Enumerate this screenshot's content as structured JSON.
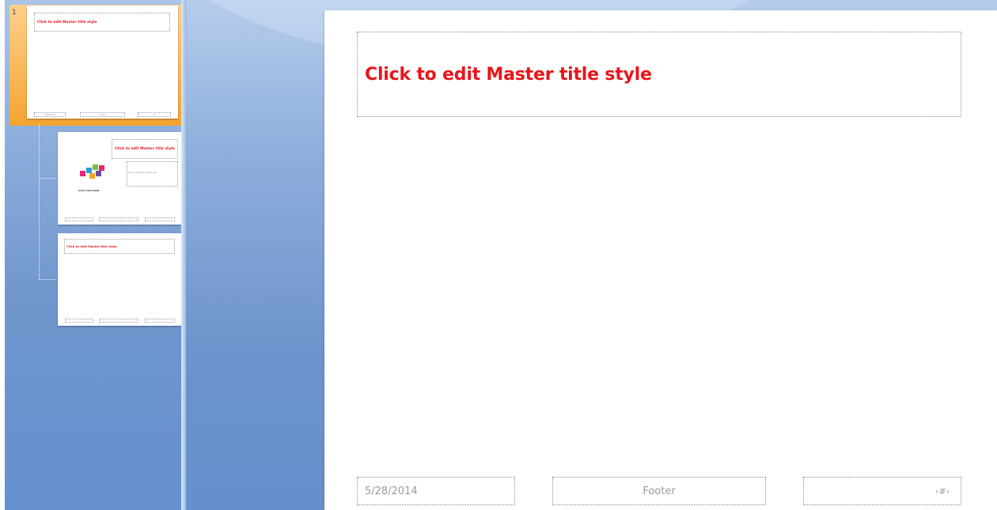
{
  "window": {
    "title": ""
  },
  "thumbnails": {
    "master": {
      "number": "1",
      "title": "Click to edit Master title style",
      "footer_date": "5/28/2014",
      "footer_center": "Footer",
      "footer_num": "‹#›"
    },
    "layout_1": {
      "title": "Click to edit Master title style",
      "subtitle": "Click to edit Master subtitle style",
      "logo_caption": "YOUR LOGO HERE"
    },
    "layout_2": {
      "title": "Click to edit Master title style"
    }
  },
  "slide": {
    "title_placeholder": "Click to edit Master title style",
    "footer_date": "5/28/2014",
    "footer_center": "Footer",
    "footer_slide_number": "‹#›"
  },
  "colors": {
    "title_red": "#e8151b",
    "selected_thumb": "#f4a431",
    "pane_blue": "#6f95cc"
  }
}
